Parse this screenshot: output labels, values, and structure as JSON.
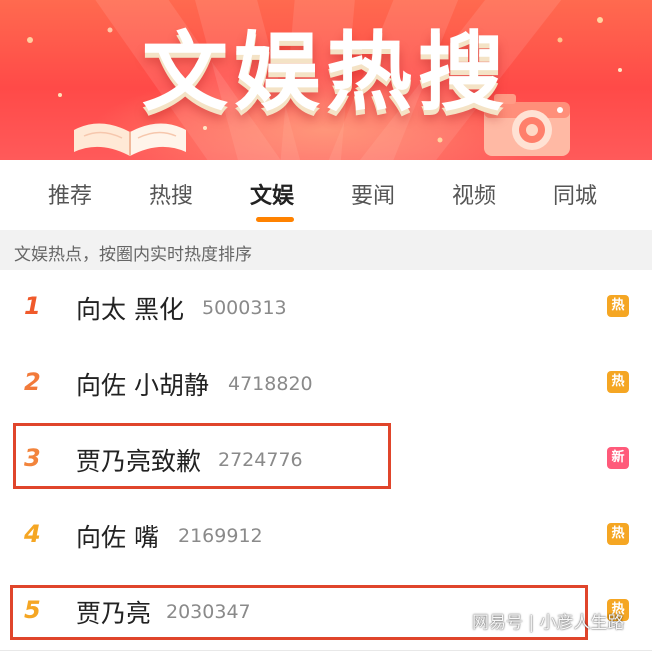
{
  "banner": {
    "title": "文娱热搜"
  },
  "tabs": [
    {
      "label": "推荐",
      "active": false
    },
    {
      "label": "热搜",
      "active": false
    },
    {
      "label": "文娱",
      "active": true
    },
    {
      "label": "要闻",
      "active": false
    },
    {
      "label": "视频",
      "active": false
    },
    {
      "label": "同城",
      "active": false
    }
  ],
  "subheader": {
    "text": "文娱热点，按圈内实时热度排序"
  },
  "list": [
    {
      "rank": "1",
      "title": "向太 黑化",
      "count": "5000313",
      "badge": "热",
      "badge_color": "#f5a623",
      "rank_color": "#f05a2b"
    },
    {
      "rank": "2",
      "title": "向佐 小胡静",
      "count": "4718820",
      "badge": "热",
      "badge_color": "#f5a623",
      "rank_color": "#f27a3a"
    },
    {
      "rank": "3",
      "title": "贾乃亮致歉",
      "count": "2724776",
      "badge": "新",
      "badge_color": "#ff5a7a",
      "rank_color": "#f2843c"
    },
    {
      "rank": "4",
      "title": "向佐 嘴",
      "count": "2169912",
      "badge": "热",
      "badge_color": "#f5a623",
      "rank_color": "#f5a623"
    },
    {
      "rank": "5",
      "title": "贾乃亮",
      "count": "2030347",
      "badge": "热",
      "badge_color": "#f5a623",
      "rank_color": "#f5a623"
    }
  ],
  "watermark": "网易号 | 小彦人生路",
  "colors": {
    "accent": "#ff8200",
    "highlight_box": "#e0452b",
    "banner_top": "#ff6a4f",
    "banner_bottom": "#ff5a5a"
  }
}
